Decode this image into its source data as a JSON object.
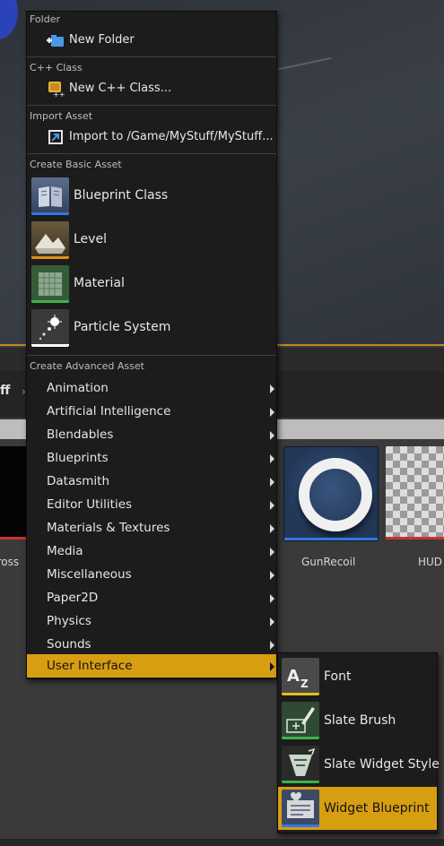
{
  "colors": {
    "accent": "#d79e12",
    "blueprint_strip": "#2f7ae0",
    "level_strip": "#e0901a",
    "material_strip": "#3cb34a",
    "particle_strip": "#ffffff",
    "red_strip": "#c83232",
    "menu_bg": "#1c1c1c"
  },
  "background": {
    "path_fragment": "ff",
    "path_separator": "›",
    "assets": [
      {
        "label": "cross",
        "icon": "black-texture"
      },
      {
        "label": "GunRecoil",
        "icon": "ring-material"
      },
      {
        "label": "HUD",
        "icon": "checker-texture"
      }
    ]
  },
  "menu": {
    "sections": {
      "folder": "Folder",
      "cpp": "C++ Class",
      "import": "Import Asset",
      "basic": "Create Basic Asset",
      "advanced": "Create Advanced Asset"
    },
    "new_folder": {
      "label": "New Folder",
      "icon": "new-folder-icon"
    },
    "new_cpp": {
      "label": "New C++ Class...",
      "icon": "cpp-class-icon"
    },
    "import_to": {
      "label": "Import to /Game/MyStuff/MyStuff...",
      "icon": "import-icon"
    },
    "basic_items": [
      {
        "label": "Blueprint Class",
        "icon": "blueprint-class-icon"
      },
      {
        "label": "Level",
        "icon": "level-icon"
      },
      {
        "label": "Material",
        "icon": "material-icon"
      },
      {
        "label": "Particle System",
        "icon": "particle-system-icon"
      }
    ],
    "advanced_items": [
      "Animation",
      "Artificial Intelligence",
      "Blendables",
      "Blueprints",
      "Datasmith",
      "Editor Utilities",
      "Materials & Textures",
      "Media",
      "Miscellaneous",
      "Paper2D",
      "Physics",
      "Sounds",
      "User Interface"
    ],
    "selected_advanced": "User Interface"
  },
  "submenu": {
    "items": [
      {
        "label": "Font",
        "icon": "font-icon"
      },
      {
        "label": "Slate Brush",
        "icon": "slate-brush-icon"
      },
      {
        "label": "Slate Widget Style",
        "icon": "slate-widget-style-icon"
      },
      {
        "label": "Widget Blueprint",
        "icon": "widget-blueprint-icon"
      }
    ],
    "selected": "Widget Blueprint"
  }
}
